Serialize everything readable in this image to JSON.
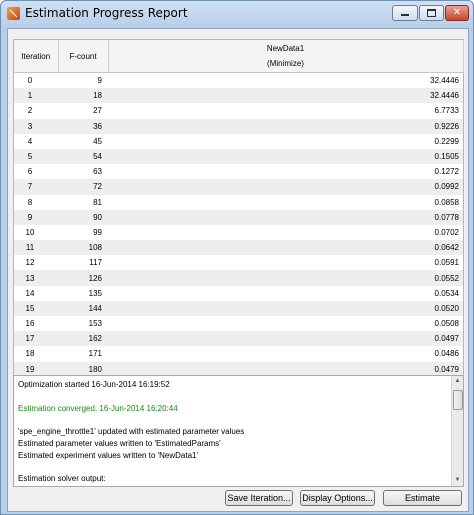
{
  "window": {
    "title": "Estimation Progress Report",
    "min_icon": "minimize-icon",
    "max_icon": "maximize-icon",
    "close_icon": "close-icon",
    "close_label": "✕"
  },
  "table": {
    "headers": {
      "iteration": "Iteration",
      "fcount": "F-count",
      "newdata": "NewData1",
      "newdata_sub": "(Minimize)"
    },
    "rows": [
      {
        "iteration": "0",
        "fcount": "9",
        "value": "32.4446"
      },
      {
        "iteration": "1",
        "fcount": "18",
        "value": "32.4446"
      },
      {
        "iteration": "2",
        "fcount": "27",
        "value": "6.7733"
      },
      {
        "iteration": "3",
        "fcount": "36",
        "value": "0.9226"
      },
      {
        "iteration": "4",
        "fcount": "45",
        "value": "0.2299"
      },
      {
        "iteration": "5",
        "fcount": "54",
        "value": "0.1505"
      },
      {
        "iteration": "6",
        "fcount": "63",
        "value": "0.1272"
      },
      {
        "iteration": "7",
        "fcount": "72",
        "value": "0.0992"
      },
      {
        "iteration": "8",
        "fcount": "81",
        "value": "0.0858"
      },
      {
        "iteration": "9",
        "fcount": "90",
        "value": "0.0778"
      },
      {
        "iteration": "10",
        "fcount": "99",
        "value": "0.0702"
      },
      {
        "iteration": "11",
        "fcount": "108",
        "value": "0.0642"
      },
      {
        "iteration": "12",
        "fcount": "117",
        "value": "0.0591"
      },
      {
        "iteration": "13",
        "fcount": "126",
        "value": "0.0552"
      },
      {
        "iteration": "14",
        "fcount": "135",
        "value": "0.0534"
      },
      {
        "iteration": "15",
        "fcount": "144",
        "value": "0.0520"
      },
      {
        "iteration": "16",
        "fcount": "153",
        "value": "0.0508"
      },
      {
        "iteration": "17",
        "fcount": "162",
        "value": "0.0497"
      },
      {
        "iteration": "18",
        "fcount": "171",
        "value": "0.0486"
      },
      {
        "iteration": "19",
        "fcount": "180",
        "value": "0.0479"
      }
    ]
  },
  "log": {
    "lines": [
      {
        "text": "Optimization started 16-Jun-2014 16:19:52",
        "color": "#000000"
      },
      {
        "text": "",
        "color": "#000000"
      },
      {
        "text": "Estimation converged, 16-Jun-2014 16:20:44",
        "color": "#178c17"
      },
      {
        "text": "",
        "color": "#000000"
      },
      {
        "text": "'spe_engine_throttle1' updated with estimated parameter values",
        "color": "#000000"
      },
      {
        "text": "Estimated parameter values written to 'EstimatedParams'",
        "color": "#000000"
      },
      {
        "text": "Estimated experiment values written to 'NewData1'",
        "color": "#000000"
      },
      {
        "text": "",
        "color": "#000000"
      },
      {
        "text": "Estimation solver output:",
        "color": "#000000"
      }
    ]
  },
  "buttons": {
    "save_iteration": "Save Iteration...",
    "display_options": "Display Options...",
    "estimate": "Estimate"
  }
}
